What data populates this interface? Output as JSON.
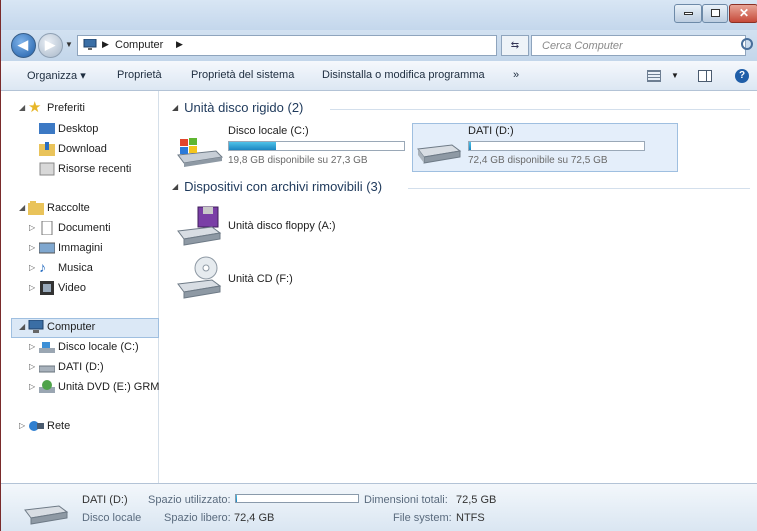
{
  "window": {
    "title_buttons": {
      "minimize": "",
      "maximize": "",
      "close": "✕"
    }
  },
  "address_bar": {
    "location": "Computer",
    "search_placeholder": "Cerca Computer"
  },
  "command_bar": {
    "organize": "Organizza ▾",
    "properties": "Proprietà",
    "system_properties": "Proprietà del sistema",
    "uninstall": "Disinstalla o modifica programma",
    "more": "»"
  },
  "nav": {
    "favorites": "Preferiti",
    "desktop": "Desktop",
    "download": "Download",
    "recent": "Risorse recenti",
    "libraries": "Raccolte",
    "documents": "Documenti",
    "images": "Immagini",
    "music": "Musica",
    "video": "Video",
    "computer": "Computer",
    "local_disk": "Disco locale (C:)",
    "dati": "DATI (D:)",
    "dvd": "Unità DVD (E:) GRMC",
    "network": "Rete"
  },
  "content": {
    "hard_disks_header": "Unità disco rigido (2)",
    "removable_header": "Dispositivi con archivi rimovibili (3)",
    "drives": [
      {
        "name": "Disco locale (C:)",
        "free": "19,8 GB disponibile su 27,3 GB",
        "used_fraction": 0.27
      },
      {
        "name": "DATI (D:)",
        "free": "72,4 GB disponibile su 72,5 GB",
        "used_fraction": 0.01
      }
    ],
    "removable": [
      {
        "name": "Unità disco floppy (A:)"
      },
      {
        "name": "Unità CD (F:)"
      }
    ]
  },
  "details": {
    "name": "DATI (D:)",
    "type": "Disco locale",
    "used_label": "Spazio utilizzato:",
    "free_label": "Spazio libero:",
    "free_value": "72,4 GB",
    "total_label": "Dimensioni totali:",
    "total_value": "72,5 GB",
    "fs_label": "File system:",
    "fs_value": "NTFS",
    "used_fraction": 0.01
  },
  "colors": {
    "accent": "#1b86c2",
    "selection": "#dbe8f6"
  }
}
